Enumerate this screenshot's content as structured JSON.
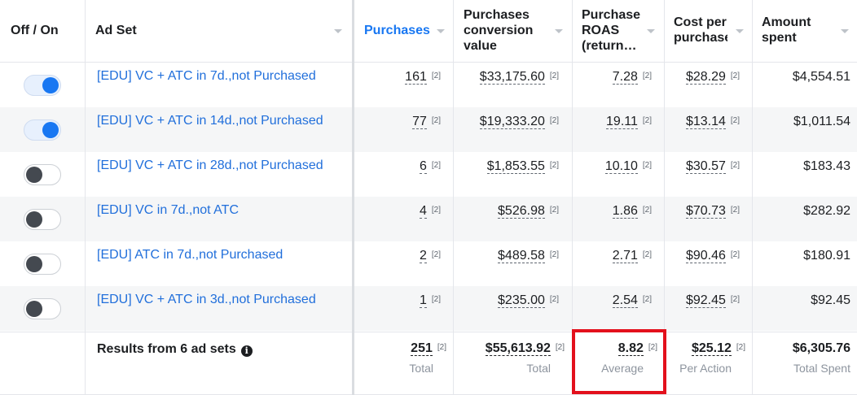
{
  "columns": {
    "toggle": "Off / On",
    "adset": "Ad Set",
    "purchases": "Purchases",
    "conv_value": [
      "Purchases",
      "conversion",
      "value"
    ],
    "roas": [
      "Purchase",
      "ROAS",
      "(return…"
    ],
    "cost": [
      "Cost per",
      "purchase"
    ],
    "spent": [
      "Amount",
      "spent"
    ]
  },
  "attribution_marker": "[2]",
  "rows": [
    {
      "on": true,
      "name": "[EDU] VC + ATC in 7d.,not Purchased",
      "purchases": "161",
      "conv_value": "$33,175.60",
      "roas": "7.28",
      "cost": "$28.29",
      "spent": "$4,554.51"
    },
    {
      "on": true,
      "name": "[EDU] VC + ATC in 14d.,not Purchased",
      "purchases": "77",
      "conv_value": "$19,333.20",
      "roas": "19.11",
      "cost": "$13.14",
      "spent": "$1,011.54"
    },
    {
      "on": false,
      "name": "[EDU] VC + ATC in 28d.,not Purchased",
      "purchases": "6",
      "conv_value": "$1,853.55",
      "roas": "10.10",
      "cost": "$30.57",
      "spent": "$183.43"
    },
    {
      "on": false,
      "name": "[EDU] VC in 7d.,not ATC",
      "purchases": "4",
      "conv_value": "$526.98",
      "roas": "1.86",
      "cost": "$70.73",
      "spent": "$282.92"
    },
    {
      "on": false,
      "name": "[EDU] ATC in 7d.,not Purchased",
      "purchases": "2",
      "conv_value": "$489.58",
      "roas": "2.71",
      "cost": "$90.46",
      "spent": "$180.91"
    },
    {
      "on": false,
      "name": "[EDU] VC + ATC in 3d.,not Purchased",
      "purchases": "1",
      "conv_value": "$235.00",
      "roas": "2.54",
      "cost": "$92.45",
      "spent": "$92.45"
    }
  ],
  "summary": {
    "label": "Results from 6 ad sets",
    "info_icon": "info-icon",
    "purchases": "251",
    "purchases_sub": "Total",
    "conv_value": "$55,613.92",
    "conv_value_sub": "Total",
    "roas": "8.82",
    "roas_sub": "Average",
    "cost": "$25.12",
    "cost_sub": "Per Action",
    "spent": "$6,305.76",
    "spent_sub": "Total Spent"
  },
  "colors": {
    "link": "#216fdb",
    "sorted_header": "#1877f2",
    "toggle_on": "#1877f2",
    "highlight": "#e3101c"
  }
}
